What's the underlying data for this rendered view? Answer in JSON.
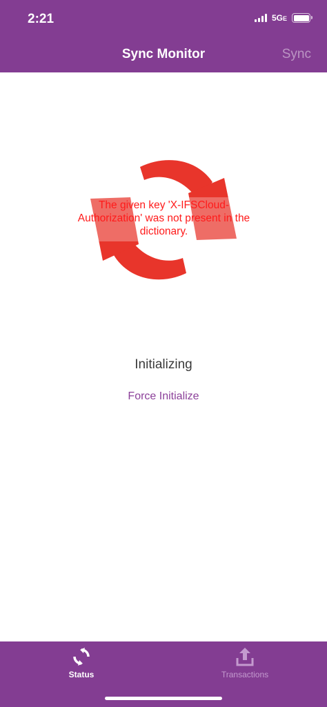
{
  "status_bar": {
    "time": "2:21",
    "network": "5G",
    "network_suffix": "E"
  },
  "nav": {
    "title": "Sync Monitor",
    "action_label": "Sync"
  },
  "sync": {
    "icon": "sync-arrows-icon",
    "error_message": "The given key 'X-IFSCloud-Authorization' was not present in the dictionary.",
    "state": "Initializing",
    "force_label": "Force Initialize",
    "accent_color": "#e8352b",
    "error_color": "#ff1a1a"
  },
  "tabs": [
    {
      "label": "Status",
      "icon": "refresh-icon",
      "active": true
    },
    {
      "label": "Transactions",
      "icon": "upload-icon",
      "active": false
    }
  ],
  "colors": {
    "brand": "#833d92",
    "link": "#8b3f99"
  }
}
